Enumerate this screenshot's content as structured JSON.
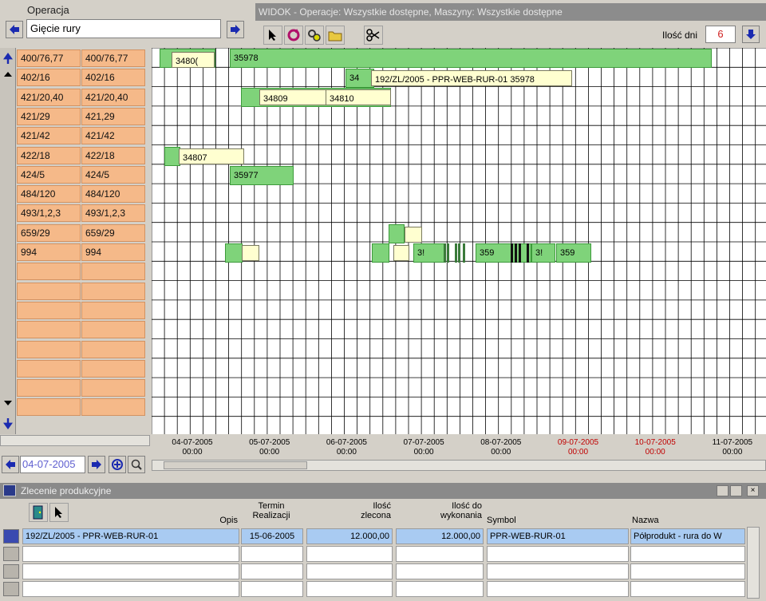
{
  "operation": {
    "label": "Operacja",
    "value": "Gięcie rury"
  },
  "window_title": "WIDOK - Operacje: Wszystkie dostępne, Maszyny: Wszystkie dostępne",
  "days": {
    "label": "Ilość dni",
    "value": "6"
  },
  "machines": [
    {
      "a": "400/76,77",
      "b": "400/76,77"
    },
    {
      "a": "402/16",
      "b": "402/16"
    },
    {
      "a": "421/20,40",
      "b": "421/20,40"
    },
    {
      "a": "421/29",
      "b": "421,29"
    },
    {
      "a": "421/42",
      "b": "421/42"
    },
    {
      "a": "422/18",
      "b": "422/18"
    },
    {
      "a": "424/5",
      "b": "424/5"
    },
    {
      "a": "484/120",
      "b": "484/120"
    },
    {
      "a": "493/1,2,3",
      "b": "493/1,2,3"
    },
    {
      "a": "659/29",
      "b": "659/29"
    },
    {
      "a": "994",
      "b": "994"
    }
  ],
  "tasks": {
    "t1": "3480(",
    "t2": "35978",
    "t3": "34",
    "tooltip": "192/ZL/2005 - PPR-WEB-RUR-01      35978",
    "t4": "34809",
    "t5": "34810",
    "t6": "34807",
    "t7": "35977",
    "t8": "3!",
    "t9": "359",
    "t10": "3!",
    "t11": "359"
  },
  "dates": [
    {
      "d": "04-07-2005",
      "t": "00:00",
      "color": "#000000"
    },
    {
      "d": "05-07-2005",
      "t": "00:00",
      "color": "#000000"
    },
    {
      "d": "06-07-2005",
      "t": "00:00",
      "color": "#000000"
    },
    {
      "d": "07-07-2005",
      "t": "00:00",
      "color": "#000000"
    },
    {
      "d": "08-07-2005",
      "t": "00:00",
      "color": "#000000"
    },
    {
      "d": "09-07-2005",
      "t": "00:00",
      "color": "#c00000"
    },
    {
      "d": "10-07-2005",
      "t": "00:00",
      "color": "#c00000"
    },
    {
      "d": "11-07-2005",
      "t": "00:00",
      "color": "#000000"
    }
  ],
  "current_date": "04-07-2005",
  "orders_window": {
    "title": "Zlecenie produkcyjne",
    "headers": {
      "opis": "Opis",
      "termin": "Termin\nRealizacji",
      "ilosc_zlecona": "Ilość\nzlecona",
      "ilosc_do": "Ilość do\nwykonania",
      "symbol": "Symbol",
      "nazwa": "Nazwa"
    },
    "rows": [
      {
        "opis": "192/ZL/2005 - PPR-WEB-RUR-01",
        "termin": "15-06-2005",
        "zlecona": "12.000,00",
        "do_wykonania": "12.000,00",
        "symbol": "PPR-WEB-RUR-01",
        "nazwa": "Półprodukt - rura do W"
      }
    ]
  }
}
